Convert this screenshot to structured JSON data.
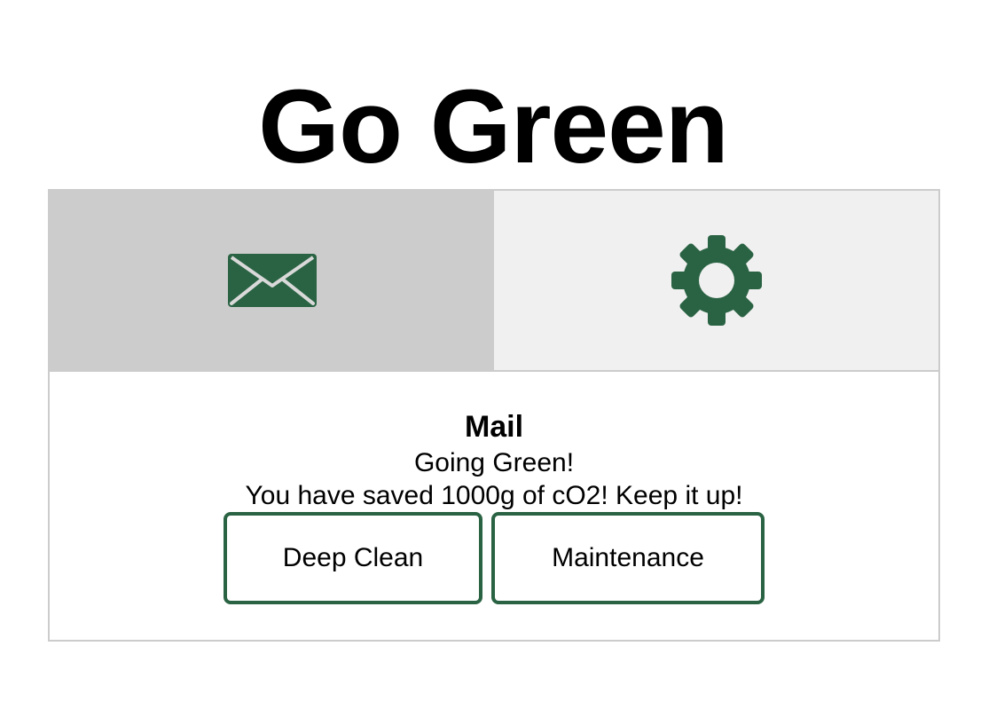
{
  "app": {
    "title": "Go Green"
  },
  "colors": {
    "accent": "#2a6343",
    "active_tab_bg": "#cccccc",
    "inactive_tab_bg": "#f0f0f0",
    "border": "#cccccc"
  },
  "tabs": [
    {
      "icon": "mail-icon",
      "active": true
    },
    {
      "icon": "gear-icon",
      "active": false
    }
  ],
  "content": {
    "title": "Mail",
    "line1": "Going Green!",
    "line2": "You have saved 1000g of cO2! Keep it up!"
  },
  "buttons": {
    "deep_clean": "Deep Clean",
    "maintenance": "Maintenance"
  }
}
